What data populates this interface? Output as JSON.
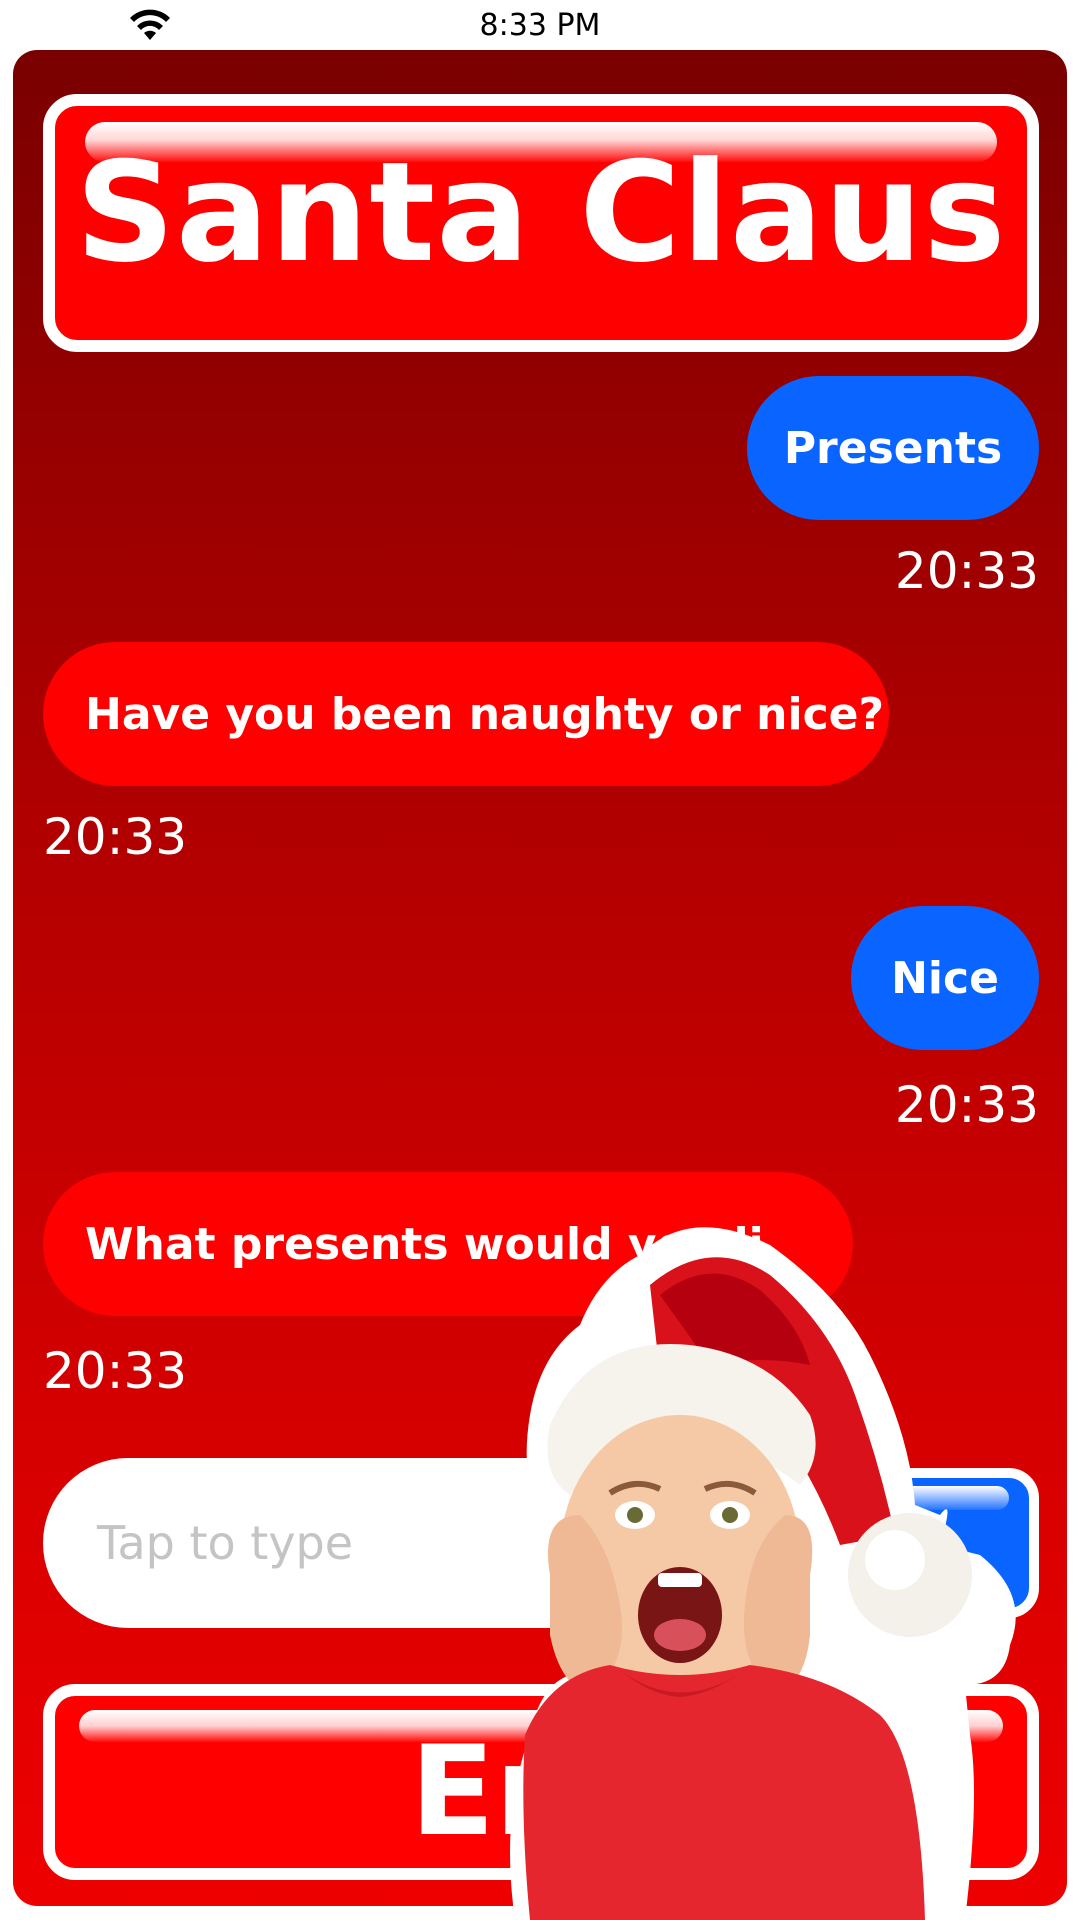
{
  "status_bar": {
    "time": "8:33 PM",
    "wifi_icon": "wifi-icon"
  },
  "header": {
    "title": "Santa Claus"
  },
  "messages": [
    {
      "sender": "user",
      "text": "Presents",
      "time": "20:33"
    },
    {
      "sender": "santa",
      "text": "Have you been naughty or nice?",
      "time": "20:33"
    },
    {
      "sender": "user",
      "text": "Nice",
      "time": "20:33"
    },
    {
      "sender": "santa",
      "text": "What presents would you li",
      "time": "20:33"
    }
  ],
  "composer": {
    "placeholder": "Tap to type"
  },
  "footer": {
    "end_label": "End"
  },
  "overlay": {
    "image": "child-in-santa-hat-sticker"
  },
  "colors": {
    "panel_top": "#7a0000",
    "panel_bottom": "#ee0000",
    "user_bubble": "#0a64ff",
    "santa_bubble": "#ff0000"
  }
}
